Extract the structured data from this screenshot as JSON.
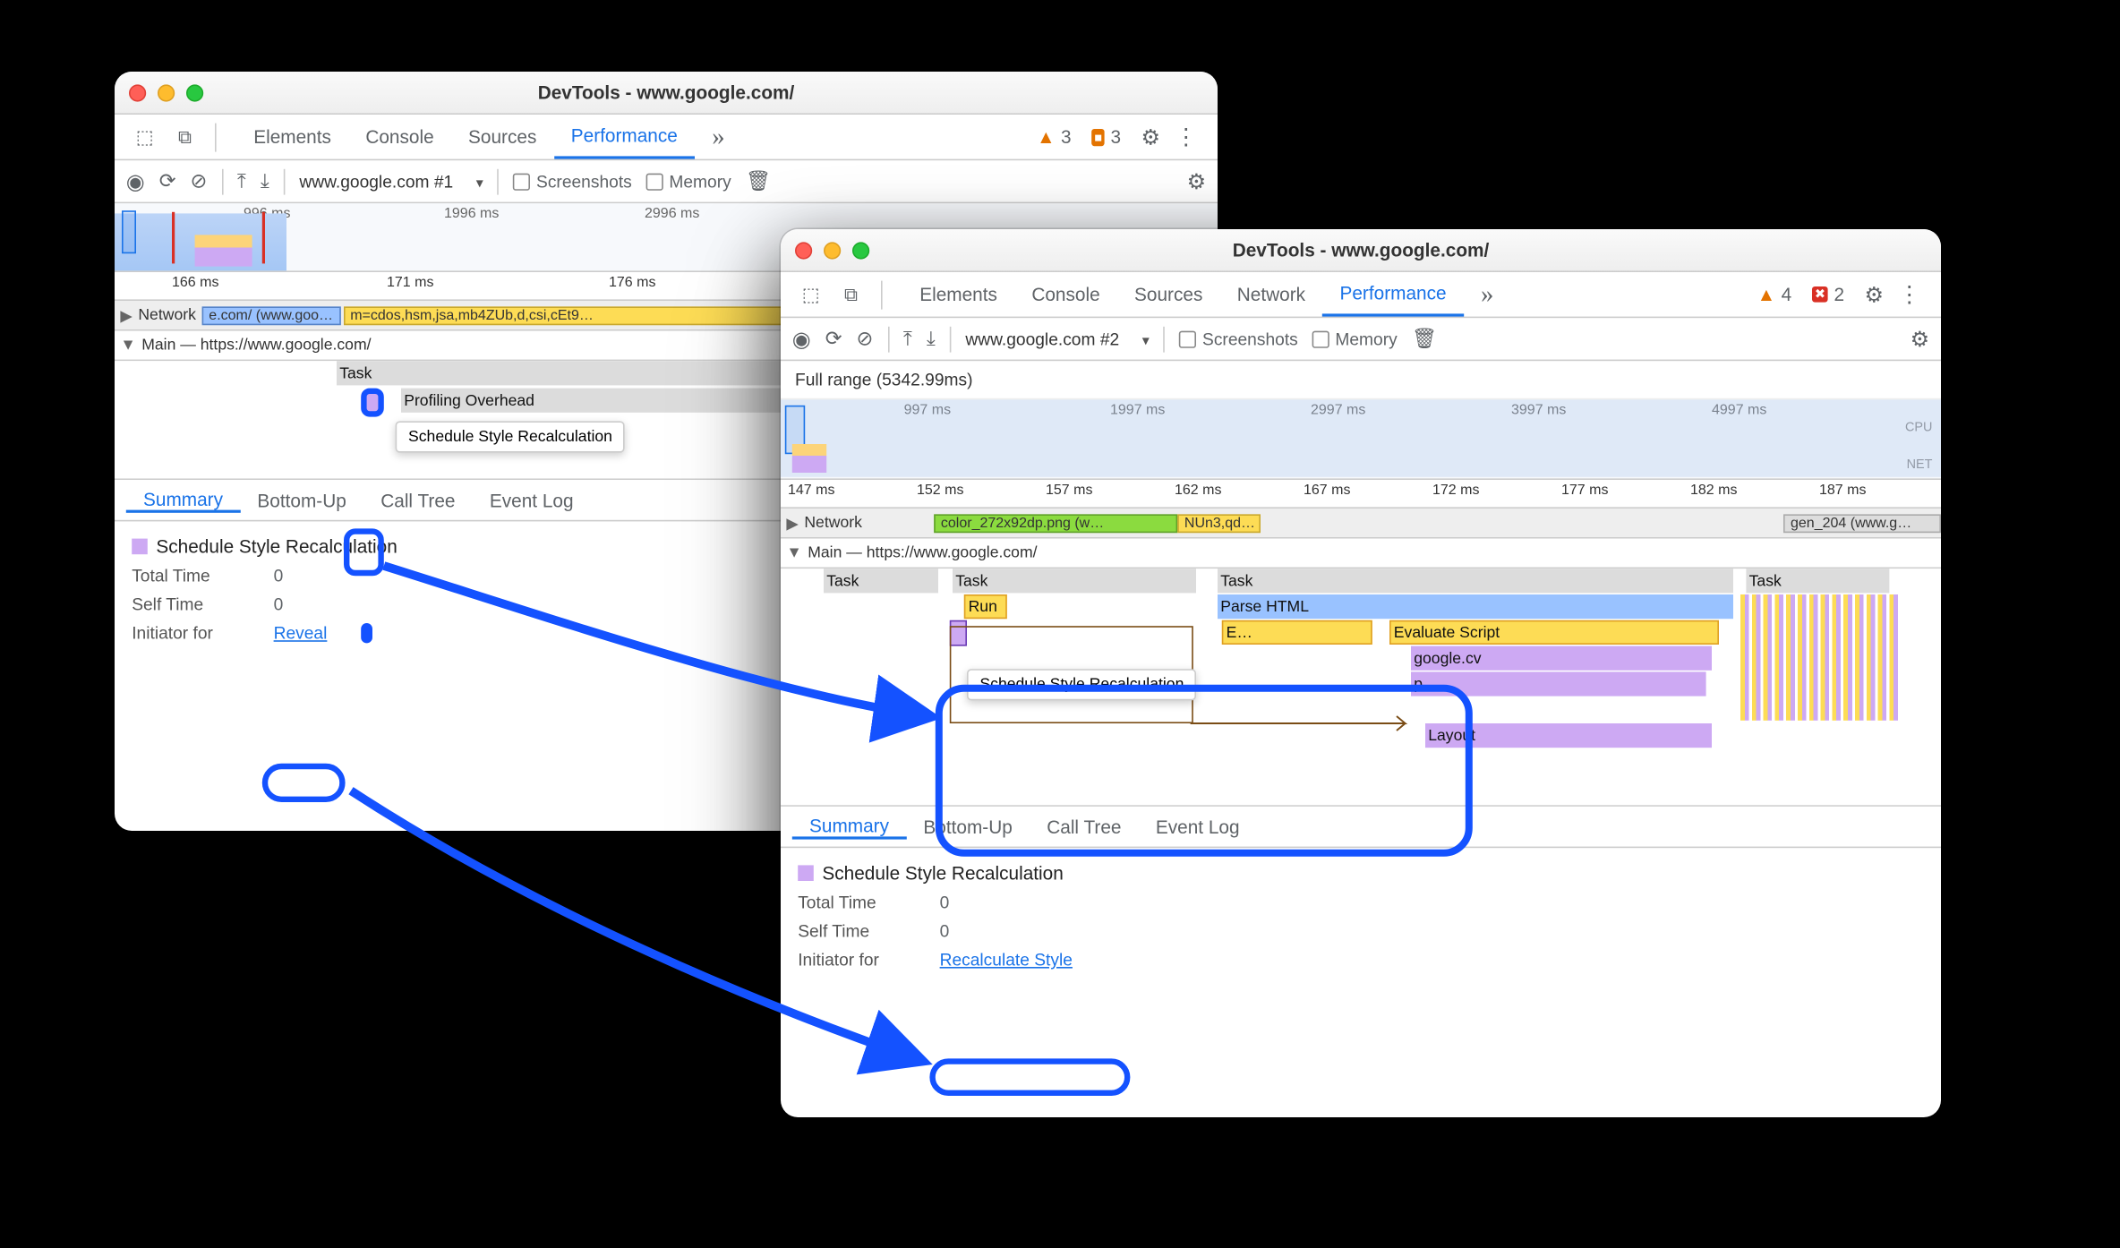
{
  "app_title": "DevTools - www.google.com/",
  "tabs_top": [
    "Elements",
    "Console",
    "Sources",
    "Performance"
  ],
  "tabs_top2": [
    "Elements",
    "Console",
    "Sources",
    "Network",
    "Performance"
  ],
  "target1": "www.google.com #1",
  "target2": "www.google.com #2",
  "checks": {
    "screenshots": "Screenshots",
    "memory": "Memory"
  },
  "overview1_ticks": [
    "996 ms",
    "1996 ms",
    "2996 ms"
  ],
  "overview2_ticks": [
    "997 ms",
    "1997 ms",
    "2997 ms",
    "3997 ms",
    "4997 ms"
  ],
  "fullrange": "Full range (5342.99ms)",
  "timerow1": [
    "166 ms",
    "171 ms",
    "176 ms"
  ],
  "timerow2": [
    "147 ms",
    "152 ms",
    "157 ms",
    "162 ms",
    "167 ms",
    "172 ms",
    "177 ms",
    "182 ms",
    "187 ms"
  ],
  "trackNet": "Network",
  "netpill1": "e.com/ (www.goo…",
  "netpill2": "m=cdos,hsm,jsa,mb4ZUb,d,csi,cEt9…",
  "net2a": "color_272x92dp.png (w…",
  "net2b": "NUn3,qd…",
  "net2c": "gen_204 (www.g…",
  "trackMain": "Main — https://www.google.com/",
  "bars": {
    "task": "Task",
    "profOver": "Profiling Overhead",
    "tooltip": "Schedule Style Recalculation",
    "run": "Run",
    "parse": "Parse HTML",
    "ev": "E…",
    "eval": "Evaluate Script",
    "gcv": "google.cv",
    "p": "p",
    "layout": "Layout"
  },
  "detailTabs": [
    "Summary",
    "Bottom-Up",
    "Call Tree",
    "Event Log"
  ],
  "event": "Schedule Style Recalculation",
  "fields": {
    "tt": "Total Time",
    "st": "Self Time",
    "init": "Initiator for"
  },
  "zero": "0",
  "reveal": "Reveal",
  "recalc": "Recalculate Style",
  "warnCount": "3",
  "issCount": "3",
  "warnCount2": "4",
  "errCount2": "2",
  "cpu": "CPU",
  "net": "NET"
}
